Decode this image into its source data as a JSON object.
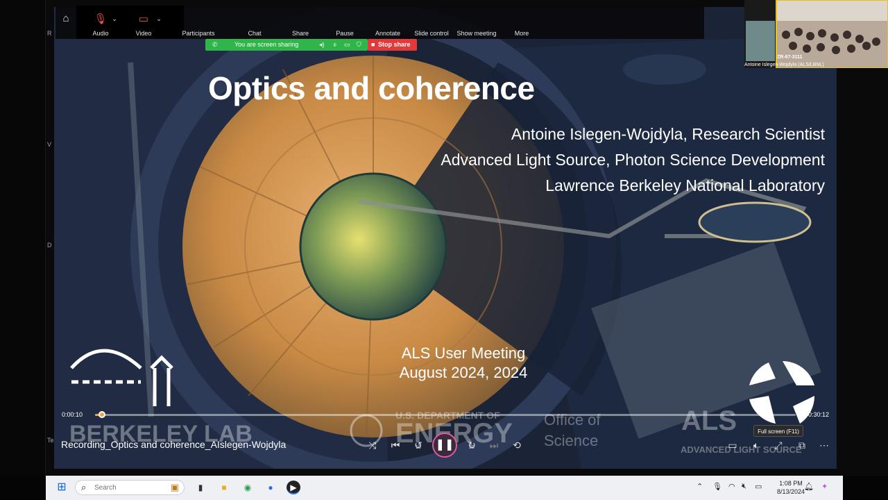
{
  "zoom": {
    "buttons": [
      {
        "label": "Audio",
        "icon": "mic-muted-icon"
      },
      {
        "label": "Video",
        "icon": "video-off-icon"
      },
      {
        "label": "Participants",
        "icon": "participants-icon"
      },
      {
        "label": "Chat",
        "icon": "chat-icon"
      },
      {
        "label": "Share",
        "icon": "share-icon"
      },
      {
        "label": "Pause",
        "icon": "pause-icon"
      },
      {
        "label": "Annotate",
        "icon": "annotate-icon"
      },
      {
        "label": "Slide control",
        "icon": "slide-control-icon"
      },
      {
        "label": "Show meeting",
        "icon": "show-meeting-icon"
      },
      {
        "label": "More",
        "icon": "more-icon"
      }
    ],
    "sharing_status": "You are screen sharing",
    "stop_share": "Stop share"
  },
  "video_thumb": {
    "room_id": "ZR-67-3111",
    "name": "Antoine Islegen-Wojdyla (ALS/LBNL)"
  },
  "slide": {
    "title": "Optics and coherence",
    "author_line": "Antoine Islegen-Wojdyla, Research Scientist",
    "affiliation_line": "Advanced Light Source, Photon Science Development",
    "lab_line": "Lawrence Berkeley National Laboratory",
    "meeting_line1": "ALS User Meeting",
    "meeting_line2": "August 2024, 2024",
    "logo_left": "BERKELEY LAB",
    "logo_doe_small": "U.S. DEPARTMENT OF",
    "logo_doe_big": "ENERGY",
    "logo_office1": "Office of",
    "logo_office2": "Science",
    "logo_als": "ALS",
    "logo_als_sub": "ADVANCED LIGHT SOURCE"
  },
  "player": {
    "time_elapsed": "0:00:10",
    "time_total": "0:30:12",
    "progress_fraction": 0.01,
    "recording_title": "Recording_Optics and coherence_AIslegen-Wojdyla",
    "fullscreen_tooltip": "Full screen (F11)",
    "skip_back_label": "10",
    "skip_forward_label": "30"
  },
  "taskbar": {
    "search_placeholder": "Search",
    "time": "1:08 PM",
    "date": "8/13/2024"
  },
  "colors": {
    "sharing_green": "#2fb54a",
    "stop_red": "#e23a3a",
    "progress_accent": "#f0a23c"
  }
}
